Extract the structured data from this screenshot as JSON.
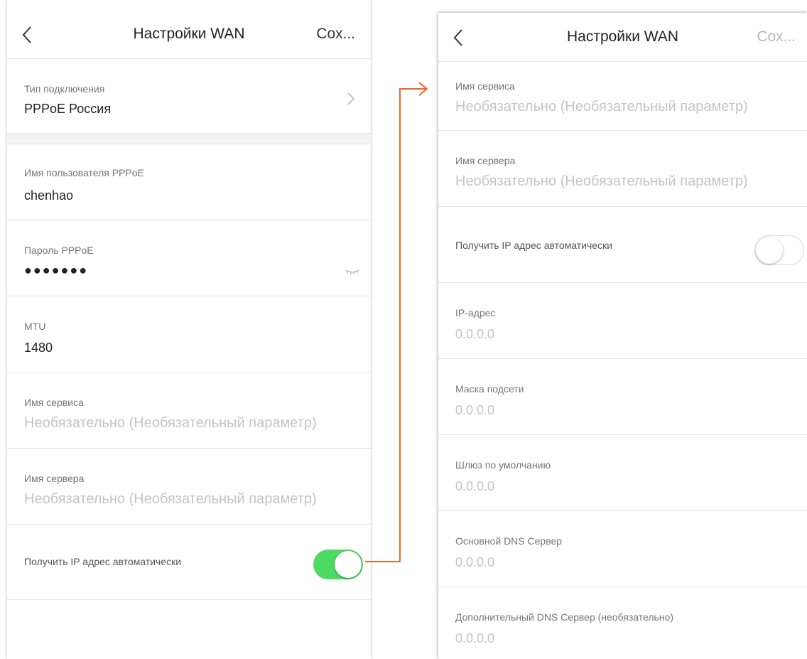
{
  "left_screen": {
    "status_fragment": "",
    "title": "Настройки WAN",
    "save_label": "Сох...",
    "connection_type": {
      "label": "Тип подключения",
      "value": "PPPoE Россия"
    },
    "username": {
      "label": "Имя пользователя PPPoE",
      "value": "chenhao"
    },
    "password": {
      "label": "Пароль PPPoE",
      "value": "●●●●●●●"
    },
    "mtu": {
      "label": "MTU",
      "value": "1480"
    },
    "service_name": {
      "label": "Имя сервиса",
      "placeholder": "Необязательно (Необязательный параметр)"
    },
    "server_name": {
      "label": "Имя сервера",
      "placeholder": "Необязательно (Необязательный параметр)"
    },
    "auto_ip": {
      "label": "Получить IP адрес автоматически",
      "enabled": true
    }
  },
  "right_screen": {
    "title": "Настройки WAN",
    "save_label": "Сох...",
    "service_name": {
      "label": "Имя сервиса",
      "placeholder": "Необязательно (Необязательный параметр)"
    },
    "server_name": {
      "label": "Имя сервера",
      "placeholder": "Необязательно (Необязательный параметр)"
    },
    "auto_ip": {
      "label": "Получить IP адрес автоматически",
      "enabled": false
    },
    "ip_address": {
      "label": "IP-адрес",
      "placeholder": "0.0.0.0"
    },
    "subnet_mask": {
      "label": "Маска подсети",
      "placeholder": "0.0.0.0"
    },
    "gateway": {
      "label": "Шлюз по умолчанию",
      "placeholder": "0.0.0.0"
    },
    "primary_dns": {
      "label": "Основной DNS Сервер",
      "placeholder": "0.0.0.0"
    },
    "secondary_dns": {
      "label": "Дополнительный DNS Сервер (необязательно)",
      "placeholder": "0.0.0.0"
    }
  },
  "colors": {
    "toggle_on": "#4cd964",
    "connector_arrow": "#f26522",
    "placeholder": "#c4c4c4"
  }
}
